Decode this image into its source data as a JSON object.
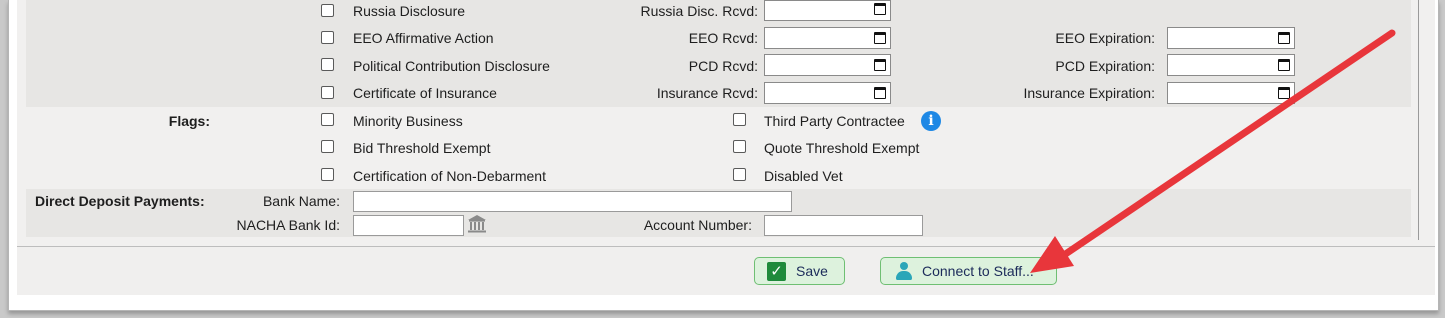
{
  "disclosures": {
    "russia_label": "Russia Disclosure",
    "russia_rcvd_label": "Russia Disc. Rcvd:",
    "eeo_label": "EEO Affirmative Action",
    "eeo_rcvd_label": "EEO Rcvd:",
    "eeo_exp_label": "EEO Expiration:",
    "pcd_label": "Political Contribution Disclosure",
    "pcd_rcvd_label": "PCD Rcvd:",
    "pcd_exp_label": "PCD Expiration:",
    "ins_label": "Certificate of Insurance",
    "ins_rcvd_label": "Insurance Rcvd:",
    "ins_exp_label": "Insurance Expiration:"
  },
  "flags": {
    "heading": "Flags:",
    "minority": "Minority Business",
    "third_party": "Third Party Contractee",
    "bid_threshold": "Bid Threshold Exempt",
    "quote_threshold": "Quote Threshold Exempt",
    "non_debarment": "Certification of Non-Debarment",
    "disabled_vet": "Disabled Vet",
    "info_glyph": "i"
  },
  "deposit": {
    "heading": "Direct Deposit Payments:",
    "bank_name_label": "Bank Name:",
    "bank_name_value": "",
    "nacha_label": "NACHA Bank Id:",
    "nacha_value": "",
    "account_label": "Account Number:",
    "account_value": ""
  },
  "footer": {
    "save_label": "Save",
    "connect_label": "Connect to Staff...",
    "check_glyph": "✓"
  },
  "icons": {
    "calendar": "calendar-icon",
    "info": "info-icon",
    "bank": "bank-icon",
    "check": "check-icon",
    "person": "person-icon",
    "annotation": "red-arrow-annotation"
  },
  "colors": {
    "accent_green": "#1f8a3b",
    "info_blue": "#1e88e5",
    "arrow_red": "#e8363b",
    "button_bg": "#ddf2dd"
  }
}
